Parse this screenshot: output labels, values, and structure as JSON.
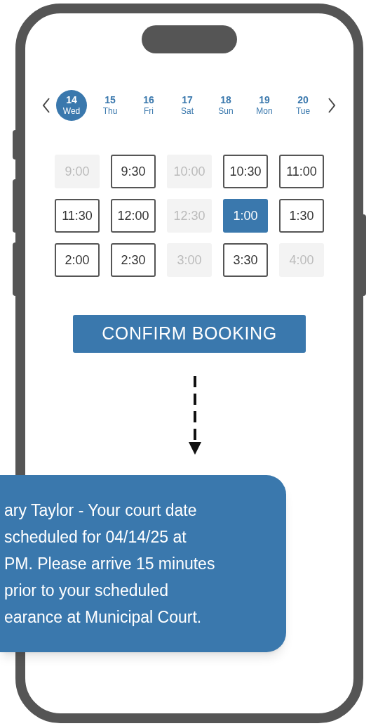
{
  "dates": [
    {
      "day": "14",
      "weekday": "Wed",
      "selected": true
    },
    {
      "day": "15",
      "weekday": "Thu",
      "selected": false
    },
    {
      "day": "16",
      "weekday": "Fri",
      "selected": false
    },
    {
      "day": "17",
      "weekday": "Sat",
      "selected": false
    },
    {
      "day": "18",
      "weekday": "Sun",
      "selected": false
    },
    {
      "day": "19",
      "weekday": "Mon",
      "selected": false
    },
    {
      "day": "20",
      "weekday": "Tue",
      "selected": false
    }
  ],
  "time_slots": [
    {
      "label": "9:00",
      "available": false,
      "selected": false
    },
    {
      "label": "9:30",
      "available": true,
      "selected": false
    },
    {
      "label": "10:00",
      "available": false,
      "selected": false
    },
    {
      "label": "10:30",
      "available": true,
      "selected": false
    },
    {
      "label": "11:00",
      "available": true,
      "selected": false
    },
    {
      "label": "11:30",
      "available": true,
      "selected": false
    },
    {
      "label": "12:00",
      "available": true,
      "selected": false
    },
    {
      "label": "12:30",
      "available": false,
      "selected": false
    },
    {
      "label": "1:00",
      "available": true,
      "selected": true
    },
    {
      "label": "1:30",
      "available": true,
      "selected": false
    },
    {
      "label": "2:00",
      "available": true,
      "selected": false
    },
    {
      "label": "2:30",
      "available": true,
      "selected": false
    },
    {
      "label": "3:00",
      "available": false,
      "selected": false
    },
    {
      "label": "3:30",
      "available": true,
      "selected": false
    },
    {
      "label": "4:00",
      "available": false,
      "selected": false
    }
  ],
  "confirm_button": "CONFIRM BOOKING",
  "message": {
    "lines": [
      "ary Taylor - Your court date",
      "scheduled for 04/14/25 at",
      "PM. Please arrive 15 minutes",
      "prior to your scheduled",
      "earance at Municipal Court."
    ]
  }
}
